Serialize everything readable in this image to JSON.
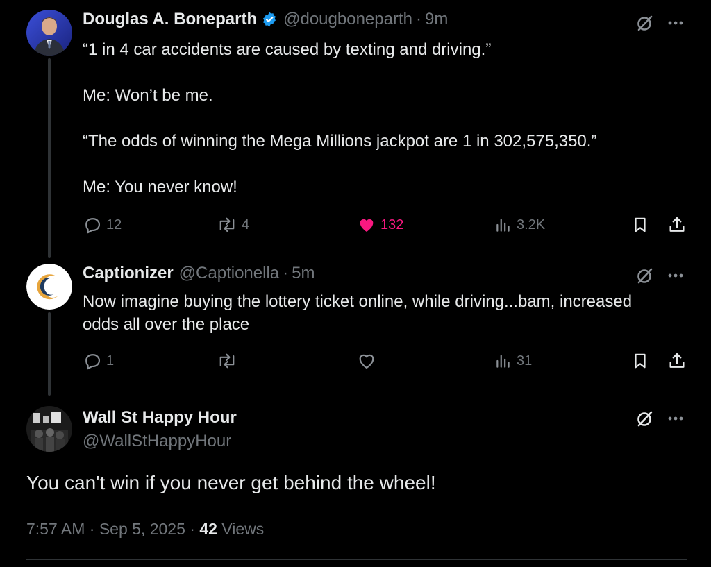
{
  "tweets": [
    {
      "display_name": "Douglas A. Boneparth",
      "handle": "@dougboneparth",
      "time": "9m",
      "text": "“1 in 4 car accidents are caused by texting and driving.”\n\nMe: Won’t be me.\n\n“The odds of winning the Mega Millions jackpot are 1 in 302,575,350.”\n\nMe: You never know!",
      "replies": "12",
      "reposts": "4",
      "likes": "132",
      "views": "3.2K",
      "verified": true
    },
    {
      "display_name": "Captionizer",
      "handle": "@Captionella",
      "time": "5m",
      "text": "Now imagine buying the lottery ticket online, while driving...bam, increased\nodds all over the place",
      "replies": "1",
      "reposts": "",
      "likes": "",
      "views": "31"
    }
  ],
  "main_tweet": {
    "display_name": "Wall St Happy Hour",
    "handle": "@WallStHappyHour",
    "text": "You can't win if you never get behind the wheel!",
    "timestamp": "7:57 AM · Sep 5, 2025 · ",
    "views_count": "42",
    "views_label": " Views"
  },
  "separator": "·",
  "colors": {
    "background": "#000000",
    "text": "#e7e9ea",
    "secondary": "#71767b",
    "like": "#f91880",
    "verified": "#1d9bf0"
  },
  "icons": [
    "grok-icon",
    "more-icon",
    "reply-icon",
    "repost-icon",
    "like-icon",
    "views-icon",
    "bookmark-icon",
    "share-icon",
    "verified-badge-icon"
  ]
}
